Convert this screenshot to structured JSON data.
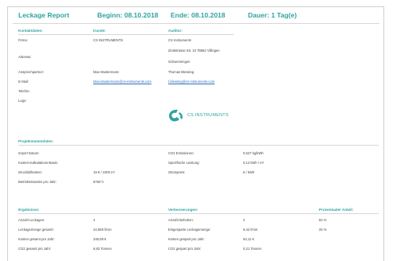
{
  "header": {
    "title": "Leckage Report",
    "begin": "Beginn: 08.10.2018",
    "end": "Ende: 08.10.2018",
    "duration": "Dauer: 1 Tag(e)"
  },
  "contact": {
    "section_title": "Kontaktdaten:",
    "customer_title": "Kunde:",
    "auditor_title": "Auditor:",
    "rows": [
      {
        "label": "Firma:",
        "customer": "CS INSTRUMENTS",
        "auditor": "CS Instruments"
      },
      {
        "label": "",
        "customer": "",
        "auditor": "Zindstrasse Str. 10 78662 Villingen"
      },
      {
        "label": "Adresse:",
        "customer": "",
        "auditor": ""
      },
      {
        "label": "",
        "customer": "",
        "auditor": "Schwenningen"
      },
      {
        "label": "Ansprechpartner:",
        "customer": "Max Mustermann",
        "auditor": "Thomas Blessing"
      },
      {
        "label": "E-Mail:",
        "customer": "Max.Mustermann@cs-instruments.com",
        "auditor": "t.blessing@cs-instruments.com"
      },
      {
        "label": "Telefon:",
        "customer": "",
        "auditor": ""
      },
      {
        "label": "Logo:",
        "customer": "",
        "auditor": ""
      }
    ],
    "logo_text": "CS INSTRUMENTS"
  },
  "project": {
    "section_title": "Projektstammdaten:",
    "left": [
      {
        "label": "Import Datum:",
        "value": ""
      },
      {
        "label": "Kosten-Kalkulations-Basis:",
        "value": ""
      },
      {
        "label": "Druckluftkosten:",
        "value": "19 € / 1000 m³"
      },
      {
        "label": "Betriebsstunden pro Jahr:",
        "value": "8760 h"
      }
    ],
    "right": [
      {
        "label": "CO2 Emissionen:",
        "value": "0,527 kg/kWh"
      },
      {
        "label": "Spezifische Leistung:",
        "value": "0,12 kWh / m³"
      },
      {
        "label": "Strompreis:",
        "value": "€ / kWh"
      }
    ]
  },
  "results": {
    "section_title": "Ergebnisse:",
    "improve_title": "Verbesserungen:",
    "percent_title": "Prozentualer Anteil:",
    "left": [
      {
        "label": "Anzahl Leckagen:",
        "value": "4"
      },
      {
        "label": "Leckagemenge gesamt:",
        "value": "24,559 l/min"
      },
      {
        "label": "Kosten gesamt pro Jahr:",
        "value": "246,08 €"
      },
      {
        "label": "CO2 gesamt pro Jahr:",
        "value": "6,82 Tonnen"
      }
    ],
    "right": [
      {
        "label": "Anzahl Behoben:",
        "value": "2",
        "percent": "50 %"
      },
      {
        "label": "Eingesparte Leckagemenge:",
        "value": "6,42 l/min",
        "percent": "26 %"
      },
      {
        "label": "Kosten gespart pro Jahr:",
        "value": "64,11 €",
        "percent": ""
      },
      {
        "label": "CO2 gespart pro Jahr:",
        "value": "0,21 Tonnen",
        "percent": ""
      }
    ]
  },
  "colors": {
    "accent": "#2fa3a0",
    "link": "#2e6ec0",
    "rule": "#d7d7d7"
  }
}
